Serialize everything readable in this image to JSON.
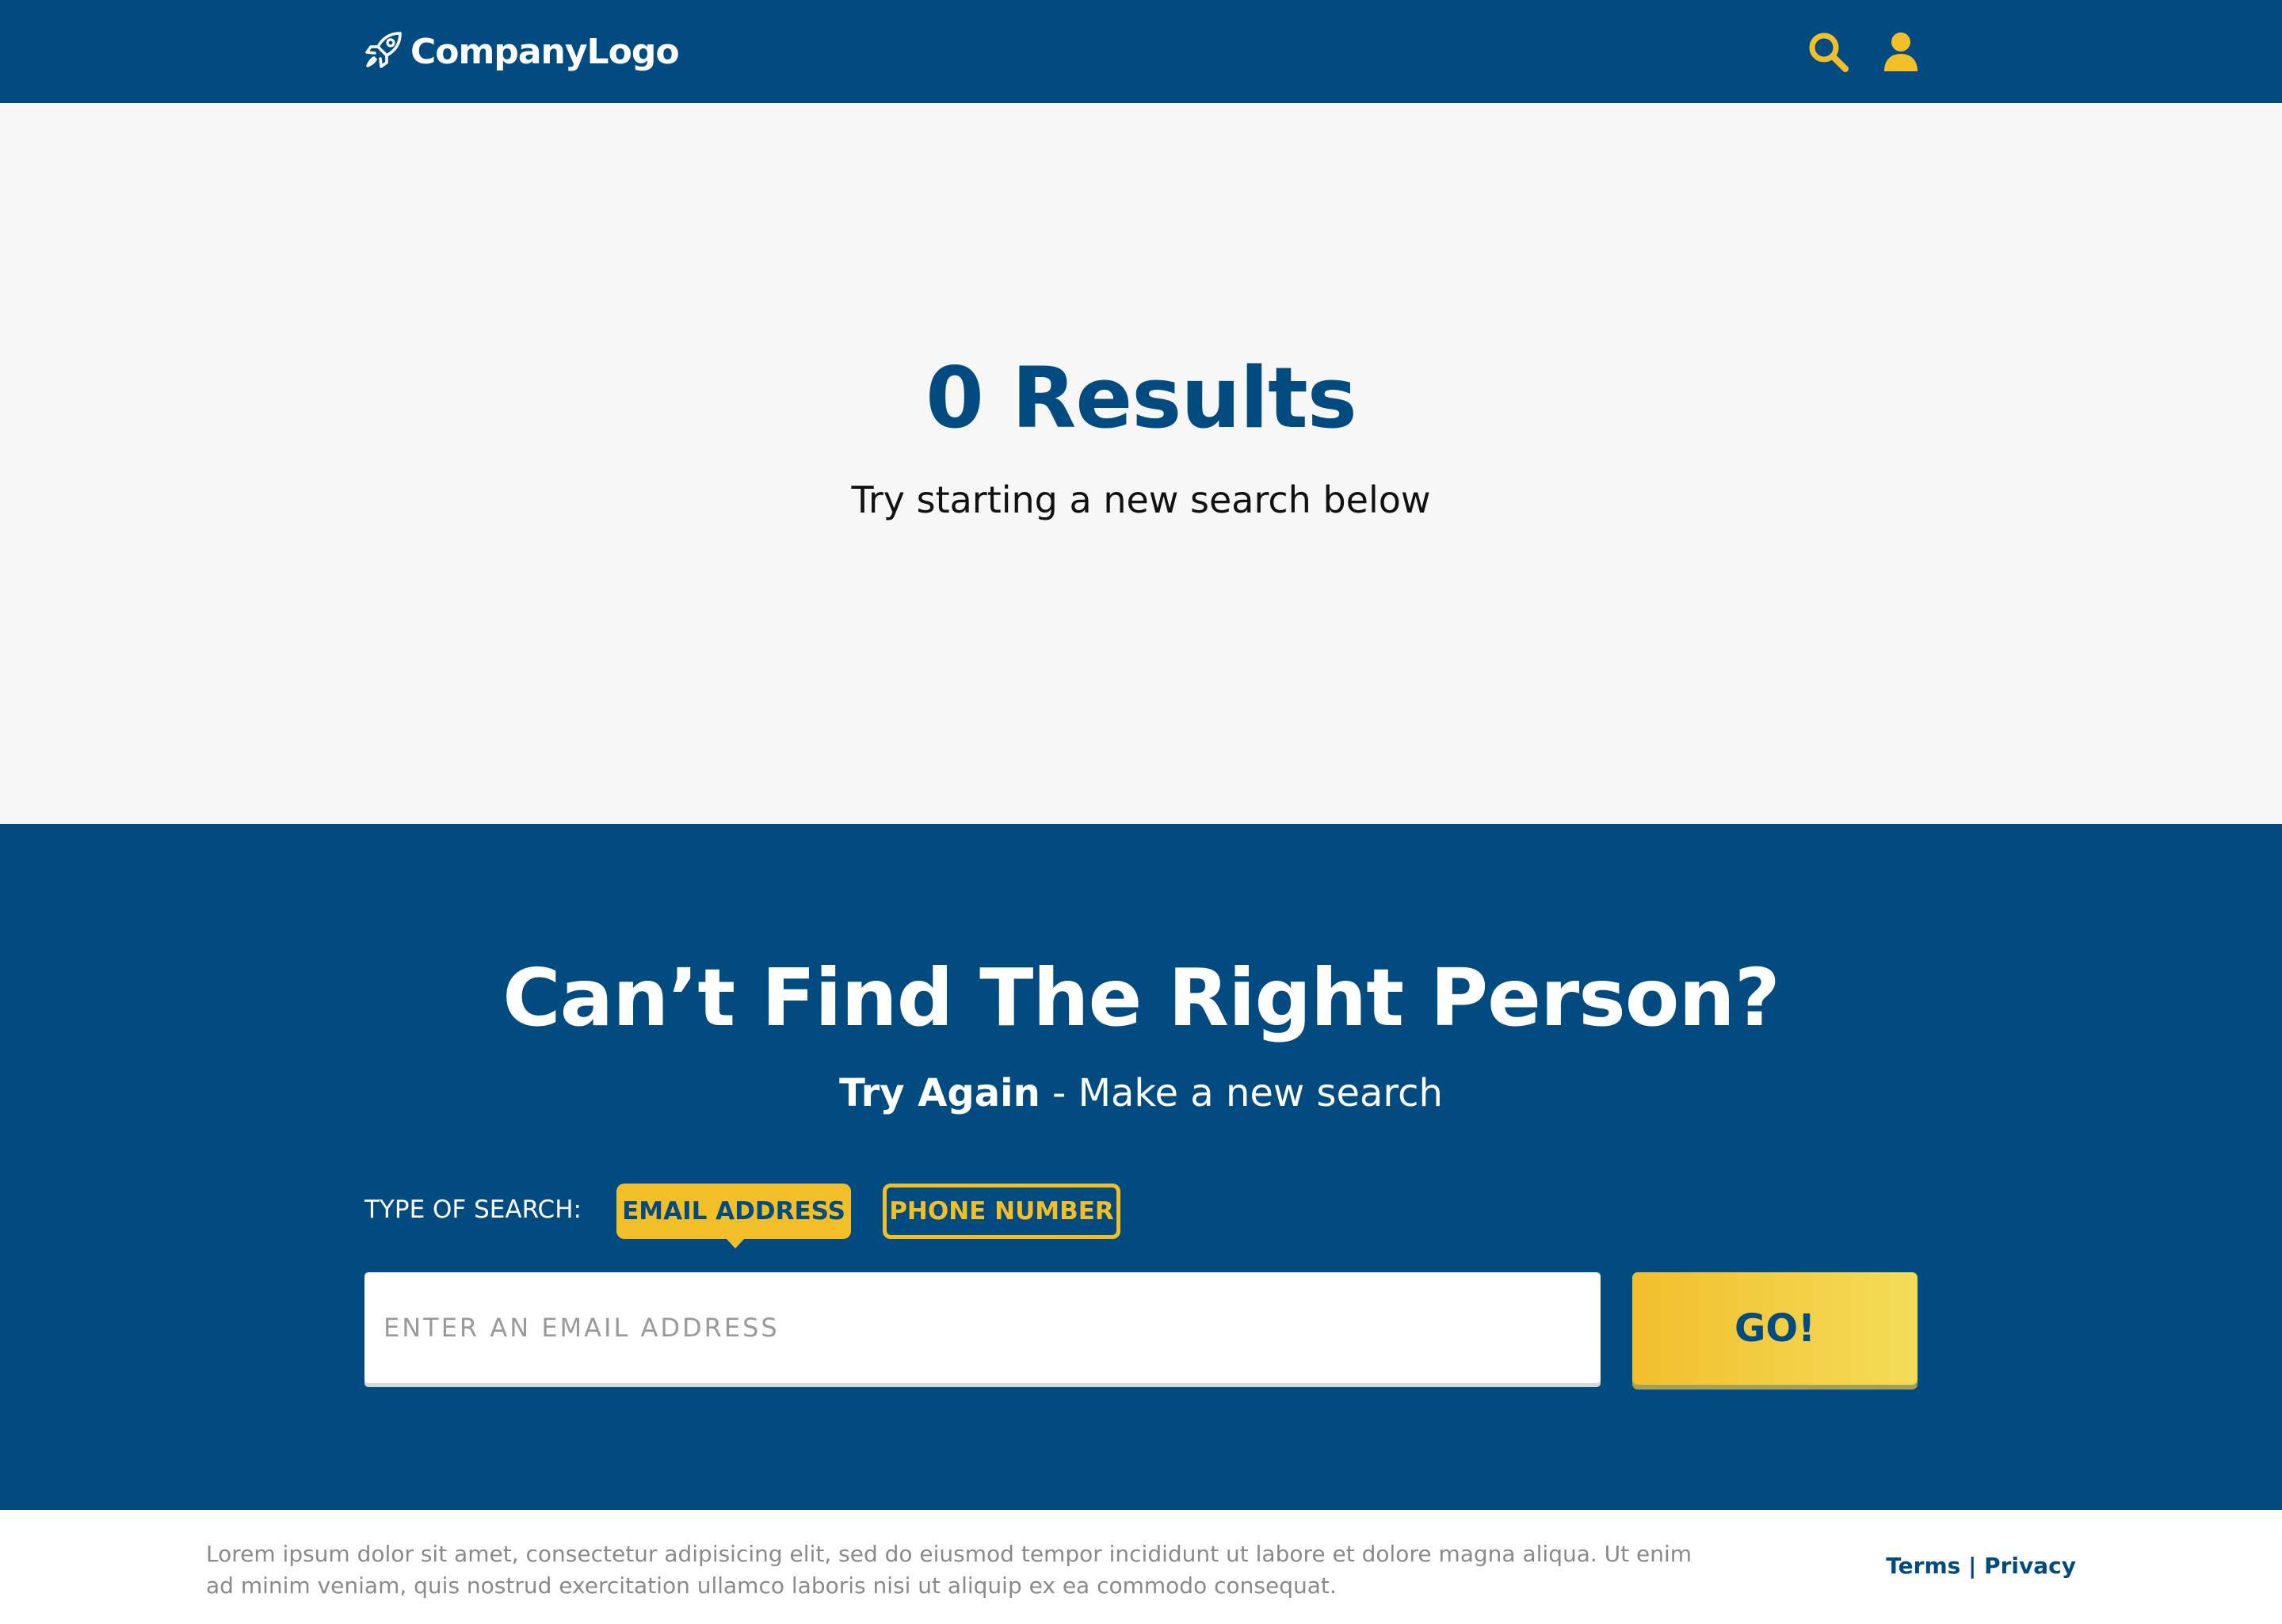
{
  "header": {
    "logo_text": "CompanyLogo",
    "icons": [
      "rocket-icon",
      "search-icon",
      "user-icon"
    ]
  },
  "results": {
    "title": "0 Results",
    "subtitle": "Try starting a new search below"
  },
  "search_section": {
    "title": "Can’t Find The Right Person?",
    "subtitle_bold": "Try Again",
    "subtitle_rest": " - Make a new search",
    "type_label": "TYPE OF SEARCH:",
    "types": [
      "EMAIL ADDRESS",
      "PHONE NUMBER"
    ],
    "selected_type": "EMAIL ADDRESS",
    "input_placeholder": "ENTER AN EMAIL ADDRESS",
    "input_value": "",
    "go_label": "GO!"
  },
  "footer": {
    "text": "Lorem ipsum dolor sit amet, consectetur adipisicing elit, sed do eiusmod tempor incididunt ut labore et dolore magna aliqua. Ut enim ad minim veniam, quis nostrud exercitation ullamco laboris nisi ut aliquip ex ea commodo consequat.",
    "terms_label": "Terms",
    "separator": " | ",
    "privacy_label": "Privacy"
  },
  "colors": {
    "brand_blue": "#024b80",
    "accent_yellow": "#f3bf28",
    "background": "#f7f7f7"
  }
}
